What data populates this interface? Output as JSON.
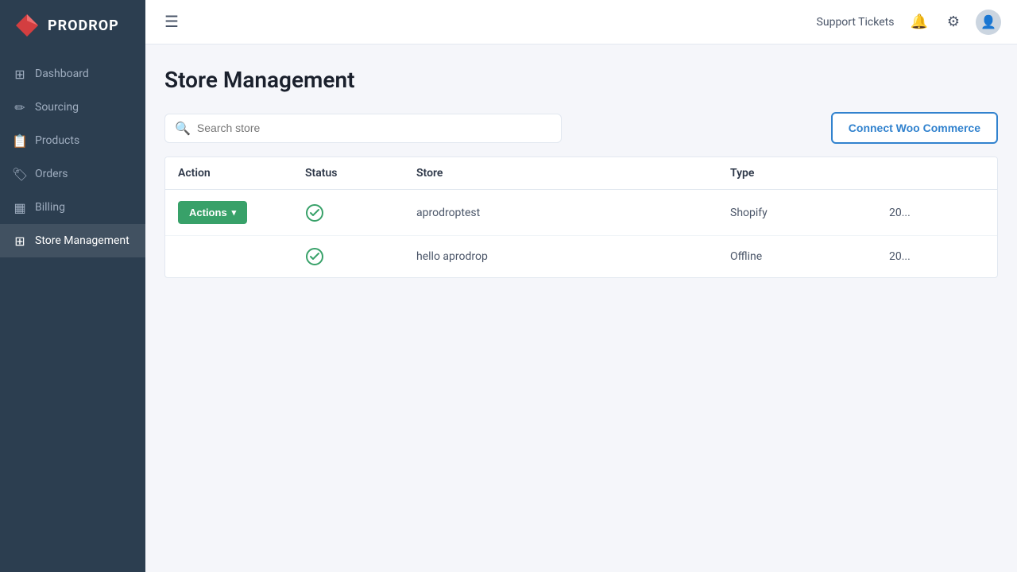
{
  "brand": {
    "name": "PRODROP"
  },
  "header": {
    "support_label": "Support Tickets",
    "hamburger_label": "☰"
  },
  "sidebar": {
    "items": [
      {
        "id": "dashboard",
        "label": "Dashboard",
        "icon": "⊞"
      },
      {
        "id": "sourcing",
        "label": "Sourcing",
        "icon": "✏"
      },
      {
        "id": "products",
        "label": "Products",
        "icon": "🏷"
      },
      {
        "id": "orders",
        "label": "Orders",
        "icon": "🏷"
      },
      {
        "id": "billing",
        "label": "Billing",
        "icon": "⊟"
      },
      {
        "id": "store-management",
        "label": "Store Management",
        "icon": "⊞"
      }
    ]
  },
  "page": {
    "title": "Store Management",
    "search_placeholder": "Search store"
  },
  "toolbar": {
    "connect_button_label": "Connect Woo Commerce"
  },
  "table": {
    "columns": [
      {
        "id": "action",
        "label": "Action"
      },
      {
        "id": "status",
        "label": "Status"
      },
      {
        "id": "store",
        "label": "Store"
      },
      {
        "id": "type",
        "label": "Type"
      },
      {
        "id": "date",
        "label": ""
      }
    ],
    "rows": [
      {
        "action_label": "Actions",
        "status_icon": "✓",
        "store": "aprodroptest",
        "type": "Shopify",
        "date": "20..."
      },
      {
        "action_label": null,
        "status_icon": "✓",
        "store": "hello aprodrop",
        "type": "Offline",
        "date": "20..."
      }
    ]
  }
}
